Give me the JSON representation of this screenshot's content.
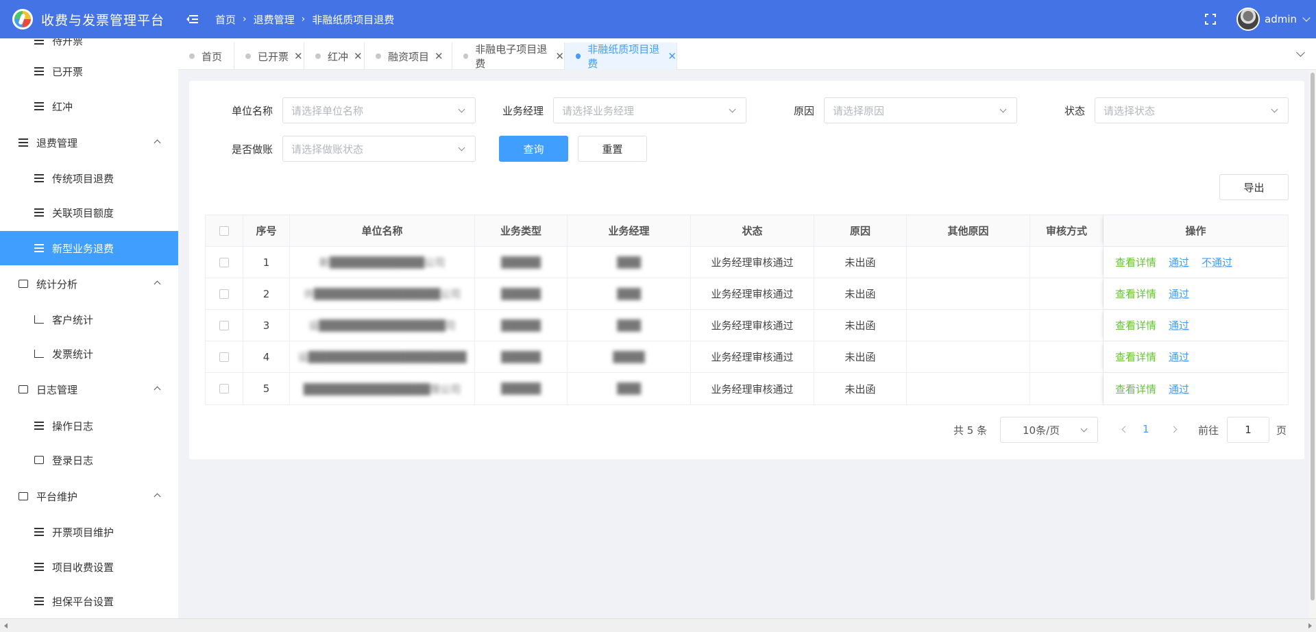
{
  "app": {
    "title": "收费与发票管理平台"
  },
  "breadcrumb": [
    "首页",
    "退费管理",
    "非融纸质项目退费"
  ],
  "user": {
    "name": "admin"
  },
  "sidebar": {
    "items": [
      {
        "label": "待开票",
        "type": "sub",
        "icon": "list-icon"
      },
      {
        "label": "已开票",
        "type": "sub",
        "icon": "list-icon"
      },
      {
        "label": "红冲",
        "type": "sub",
        "icon": "list-icon"
      },
      {
        "label": "退费管理",
        "type": "group",
        "icon": "list-icon"
      },
      {
        "label": "传统项目退费",
        "type": "sub",
        "icon": "list-icon"
      },
      {
        "label": "关联项目额度",
        "type": "sub",
        "icon": "list-icon"
      },
      {
        "label": "新型业务退费",
        "type": "sub",
        "icon": "list-icon",
        "active": true
      },
      {
        "label": "统计分析",
        "type": "group",
        "icon": "analysis-icon"
      },
      {
        "label": "客户统计",
        "type": "sub",
        "icon": "line-chart-icon"
      },
      {
        "label": "发票统计",
        "type": "sub",
        "icon": "bar-chart-icon"
      },
      {
        "label": "日志管理",
        "type": "group",
        "icon": "log-icon"
      },
      {
        "label": "操作日志",
        "type": "sub",
        "icon": "list-icon"
      },
      {
        "label": "登录日志",
        "type": "sub",
        "icon": "document-icon"
      },
      {
        "label": "平台维护",
        "type": "group",
        "icon": "grid-icon"
      },
      {
        "label": "开票项目维护",
        "type": "sub",
        "icon": "list-icon"
      },
      {
        "label": "项目收费设置",
        "type": "sub",
        "icon": "list-icon"
      },
      {
        "label": "担保平台设置",
        "type": "sub",
        "icon": "list-icon"
      }
    ]
  },
  "tabs": [
    {
      "label": "首页",
      "closable": false
    },
    {
      "label": "已开票",
      "closable": true
    },
    {
      "label": "红冲",
      "closable": true
    },
    {
      "label": "融资项目",
      "closable": true
    },
    {
      "label": "非融电子项目退费",
      "closable": true
    },
    {
      "label": "非融纸质项目退费",
      "closable": true,
      "active": true
    }
  ],
  "filters": {
    "unit_label": "单位名称",
    "unit_placeholder": "请选择单位名称",
    "manager_label": "业务经理",
    "manager_placeholder": "请选择业务经理",
    "reason_label": "原因",
    "reason_placeholder": "请选择原因",
    "status_label": "状态",
    "status_placeholder": "请选择状态",
    "account_label": "是否做账",
    "account_placeholder": "请选择做账状态",
    "query_button": "查询",
    "reset_button": "重置",
    "export_button": "导出"
  },
  "table": {
    "headers": [
      "序号",
      "单位名称",
      "业务类型",
      "业务经理",
      "状态",
      "原因",
      "其他原因",
      "审核方式",
      "操作"
    ],
    "rows": [
      {
        "no": "1",
        "unit": "新████████████公司",
        "type": "█████",
        "manager": "███",
        "status": "业务经理审核通过",
        "reason": "未出函",
        "other": "",
        "audit": "",
        "actions": [
          "查看详情",
          "通过",
          "不通过"
        ]
      },
      {
        "no": "2",
        "unit": "许████████████████公司",
        "type": "█████",
        "manager": "███",
        "status": "业务经理审核通过",
        "reason": "未出函",
        "other": "",
        "audit": "",
        "actions": [
          "查看详情",
          "通过"
        ]
      },
      {
        "no": "3",
        "unit": "设████████████████司",
        "type": "█████",
        "manager": "███",
        "status": "业务经理审核通过",
        "reason": "未出函",
        "other": "",
        "audit": "",
        "actions": [
          "查看详情",
          "通过"
        ]
      },
      {
        "no": "4",
        "unit": "设████████████████████",
        "type": "█████",
        "manager": "████",
        "status": "业务经理审核通过",
        "reason": "未出函",
        "other": "",
        "audit": "",
        "actions": [
          "查看详情",
          "通过"
        ]
      },
      {
        "no": "5",
        "unit": "████████████████限公司",
        "type": "█████",
        "manager": "███",
        "status": "业务经理审核通过",
        "reason": "未出函",
        "other": "",
        "audit": "",
        "actions": [
          "查看详情",
          "通过"
        ]
      }
    ]
  },
  "pagination": {
    "total": "共 5 条",
    "page_size": "10条/页",
    "current_page": "1",
    "goto_label": "前往",
    "goto_value": "1",
    "page_suffix": "页"
  },
  "colors": {
    "header": "#4473e6",
    "primary": "#409eff",
    "success": "#67c23a"
  }
}
